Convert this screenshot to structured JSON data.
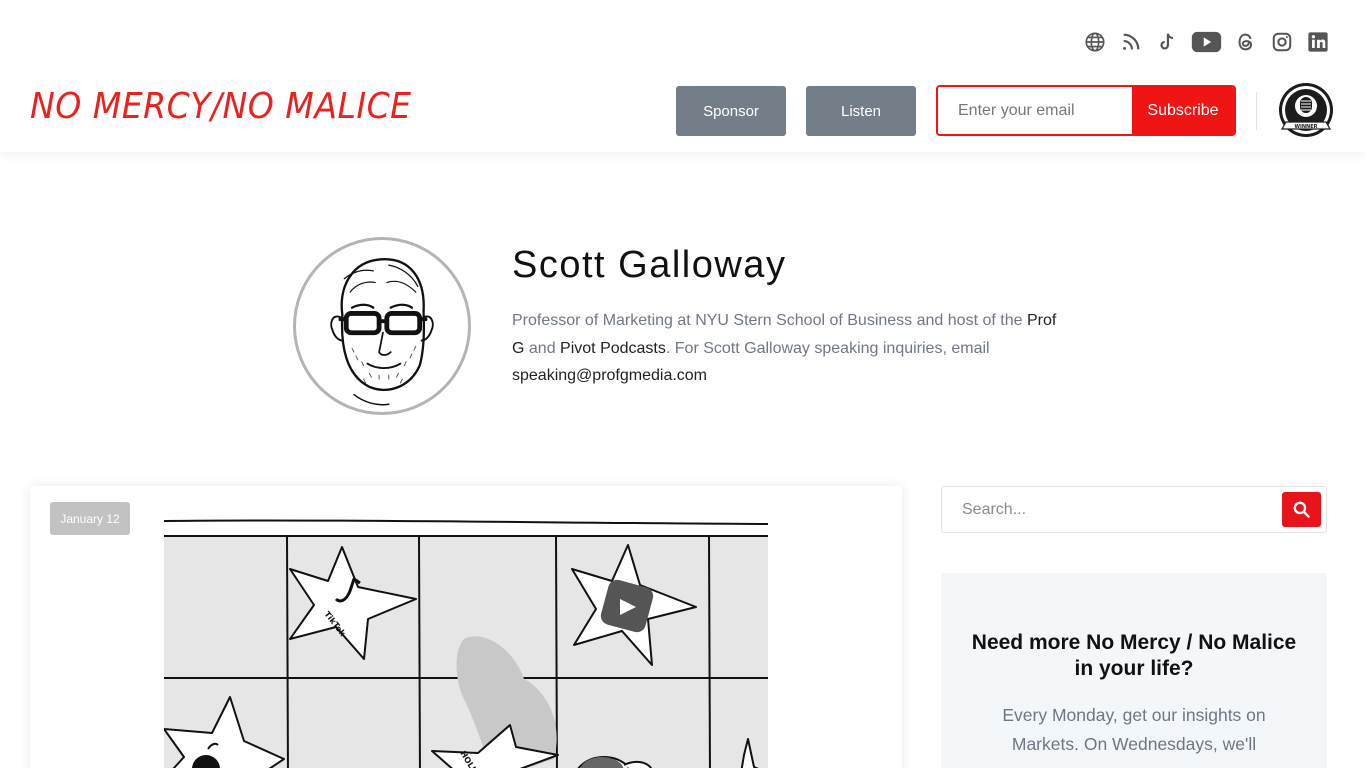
{
  "header": {
    "logo_text": "NO MERCY/NO MALICE",
    "sponsor_label": "Sponsor",
    "listen_label": "Listen",
    "email_placeholder": "Enter your email",
    "subscribe_label": "Subscribe",
    "badge_text": "WINNER",
    "social_icons": [
      "globe-icon",
      "rss-icon",
      "tiktok-icon",
      "youtube-icon",
      "threads-icon",
      "instagram-icon",
      "linkedin-icon"
    ]
  },
  "author": {
    "name": "Scott Galloway",
    "bio_part1": "Professor of Marketing at NYU Stern School of Business and host of the ",
    "bio_link1": "Prof G",
    "bio_part2": " and ",
    "bio_link2": "Pivot Podcasts",
    "bio_part3": ". For Scott Galloway speaking inquiries, email ",
    "bio_email": "speaking@profgmedia.com"
  },
  "post": {
    "date": "January 12",
    "star_labels": [
      "TikTok",
      "HOLLYWO"
    ]
  },
  "sidebar": {
    "search_placeholder": "Search...",
    "promo_title": "Need more No Mercy / No Malice in your life?",
    "promo_text": "Every Monday, get our insights on Markets. On Wednesdays, we'll"
  },
  "colors": {
    "brand_red": "#e8231f",
    "subscribe_red": "#f01414",
    "gray_button": "#737e88",
    "promo_bg": "#f4f7fa"
  }
}
